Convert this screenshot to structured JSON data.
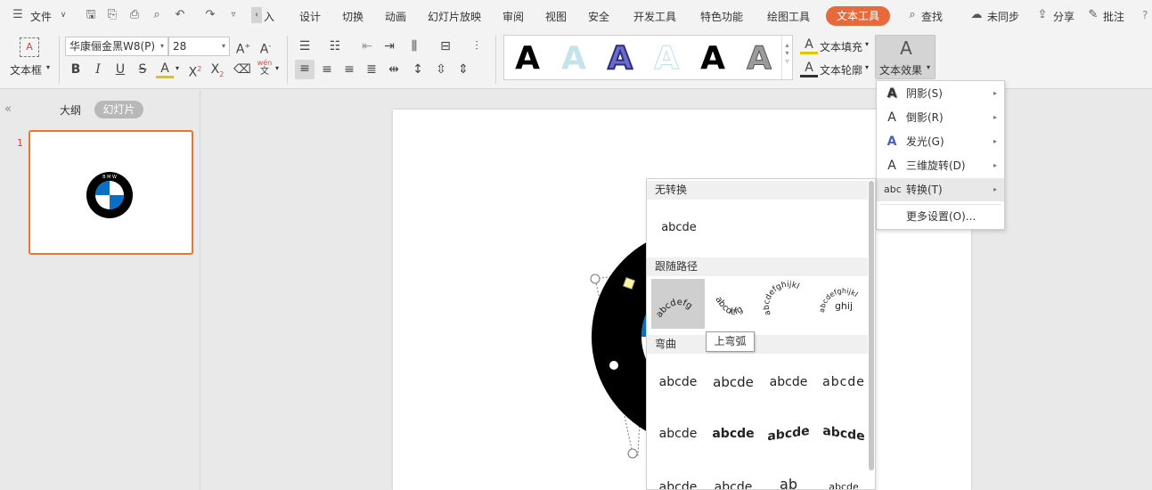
{
  "menubar": {
    "file_label": "文件",
    "tabs": [
      "插入",
      "设计",
      "切换",
      "动画",
      "幻灯片放映",
      "审阅",
      "视图",
      "安全",
      "开发工具",
      "特色功能",
      "绘图工具",
      "文本工具"
    ],
    "search_label": "查找",
    "sync_label": "未同步",
    "share_label": "分享",
    "comment_label": "批注",
    "help_label": "?"
  },
  "ribbon": {
    "textbox_label": "文本框",
    "font_name": "华康俪金黑W8(P)",
    "font_size": "28",
    "text_fill_label": "文本填充",
    "text_outline_label": "文本轮廓",
    "text_effect_label": "文本效果",
    "pinyin_label": "wén"
  },
  "leftpanel": {
    "outline_tab": "大纲",
    "slides_tab": "幻灯片",
    "slide_number": "1",
    "logo_letters": "B M W"
  },
  "effect_menu": {
    "items": [
      {
        "label": "阴影(S)",
        "icon": "shadow-A-icon"
      },
      {
        "label": "倒影(R)",
        "icon": "reflection-A-icon"
      },
      {
        "label": "发光(G)",
        "icon": "glow-A-icon"
      },
      {
        "label": "三维旋转(D)",
        "icon": "3d-rotate-A-icon"
      },
      {
        "label": "转换(T)",
        "icon": "abc-transform-icon"
      }
    ],
    "more_label": "更多设置(O)..."
  },
  "transform_panel": {
    "no_transform_header": "无转换",
    "no_transform_sample": "abcde",
    "follow_path_header": "跟随路径",
    "warp_header": "弯曲",
    "warp_samples": [
      "abcde",
      "abcde",
      "abcde",
      "abcde",
      "abcde",
      "abcde"
    ],
    "path_samples": [
      "abcdefg",
      "abcdefg",
      "abcdefghijkl",
      "ghij"
    ],
    "bottom_samples": [
      "abcde",
      "abcde",
      "ab",
      "abcde"
    ],
    "tooltip": "上弯弧"
  },
  "colors": {
    "accent": "#e8693b",
    "selection": "#e8762f",
    "bmw_blue": "#0a6fc2"
  }
}
